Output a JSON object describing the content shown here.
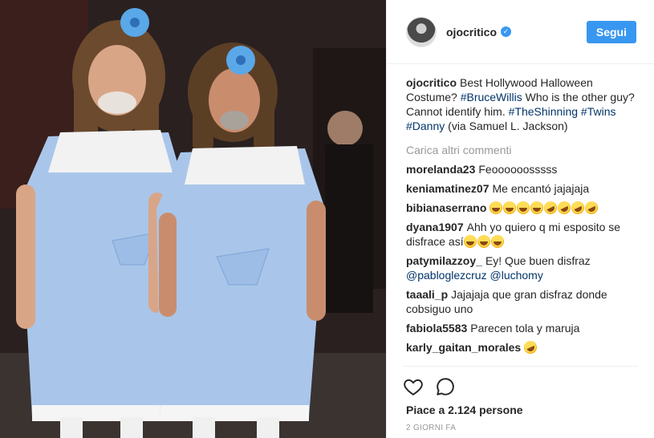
{
  "post": {
    "author": {
      "username": "ojocritico",
      "verified": true,
      "verified_icon": "verified-badge-icon"
    },
    "follow_label": "Segui",
    "caption": {
      "username": "ojocritico",
      "text_before_tag1": "Best Hollywood Halloween Costume? ",
      "tag1": "#BruceWillis",
      "text_after_tag1": " Who is the other guy? Cannot identify him. ",
      "tag2": "#TheShinning",
      "tag3": "#Twins",
      "tag4": "#Danny",
      "text_end": " (via Samuel L. Jackson)"
    },
    "load_more_label": "Carica altri commenti",
    "comments": [
      {
        "username": "morelanda23",
        "text": "Feoooooosssss"
      },
      {
        "username": "keniamatinez07",
        "text": "Me encantó jajajaja"
      },
      {
        "username": "bibianaserrano",
        "text": "",
        "emoji": [
          "laugh-cry",
          "laugh-cry",
          "laugh-cry",
          "laugh-cry",
          "rofl",
          "rofl",
          "rofl",
          "rofl"
        ]
      },
      {
        "username": "dyana1907",
        "text": "Ahh yo quiero q mi esposito se disfrace así",
        "emoji": [
          "laugh-cry",
          "laugh-cry",
          "laugh-cry"
        ]
      },
      {
        "username": "patymilazzoy_",
        "text": "Ey! Que buen disfraz ",
        "mention1": "@pabloglezcruz",
        "mention2": "@luchomy"
      },
      {
        "username": "taaali_p",
        "text": "Jajajaja que gran disfraz donde cobsiguo uno"
      },
      {
        "username": "fabiola5583",
        "text": "Parecen tola y maruja"
      },
      {
        "username": "karly_gaitan_morales",
        "text": "",
        "emoji": [
          "rofl"
        ]
      }
    ],
    "actions": {
      "like_icon": "heart-icon",
      "comment_icon": "comment-icon"
    },
    "likes_text": "Piace a 2.124 persone",
    "timestamp": "2 giorni fa"
  },
  "colors": {
    "accent": "#3897f0",
    "link": "#003569",
    "muted": "#999999",
    "text": "#262626",
    "dress": "#a9c6ea"
  }
}
